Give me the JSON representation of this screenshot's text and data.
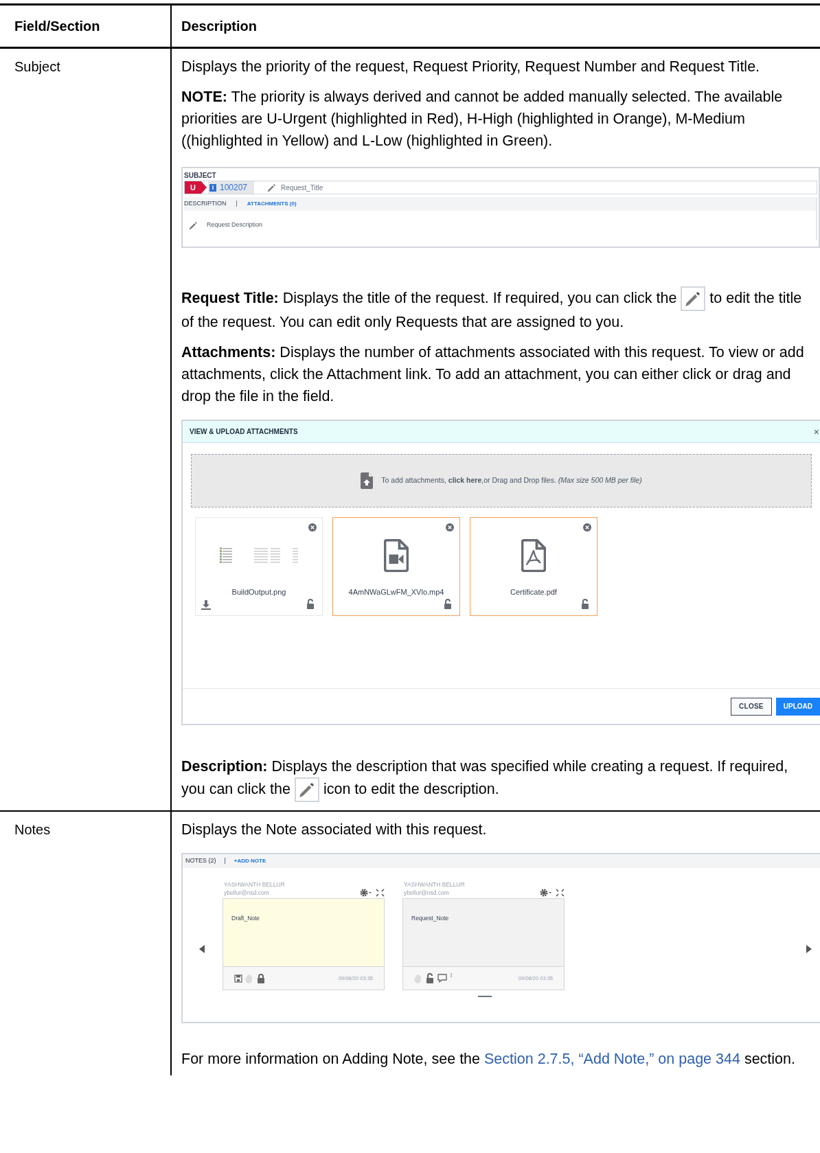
{
  "table": {
    "columns": [
      "Field/Section",
      "Description"
    ],
    "rows": [
      {
        "field": "Subject",
        "blocks": [
          {
            "kind": "paragraph",
            "text": "Displays the priority of the request, Request Priority, Request Number and Request Title."
          },
          {
            "kind": "paragraph",
            "text": "**NOTE:** The priority is always derived and cannot be added manually selected. The available priorities are U-Urgent (highlighted in Red), H-High (highlighted in Orange), M-Medium ((highlighted in Yellow) and L-Low (highlighted in Green)."
          },
          {
            "kind": "subject_panel",
            "label": "SUBJECT",
            "priority": "U",
            "type": "I",
            "number": "100207",
            "title": "Request_Title",
            "tabs": [
              {
                "label": "DESCRIPTION",
                "selected": true
              },
              {
                "label": "ATTACHMENTS (0)",
                "selected": false
              }
            ],
            "separator": "|",
            "description": "Request Description"
          },
          {
            "kind": "icon_paragraph",
            "before": "**Request Title:** Displays the title of the request. If required, you can click the",
            "after": "to edit the title of the request. You can edit only Requests that are assigned to you."
          },
          {
            "kind": "paragraph",
            "text": "**Attachments:** Displays the number of attachments associated with this request. To view or add attachments, click the Attachment link. To add an attachment, you can either click or drag and drop the file in the field."
          },
          {
            "kind": "attachments_dialog",
            "title": "VIEW & UPLOAD ATTACHMENTS",
            "close": "×",
            "drop_text": "To add attachments, **click here**,or Drag and Drop files. *(Max size 500 MB per file)*",
            "files": [
              {
                "name": "BuildOutput.png",
                "kind": "image",
                "selected": false,
                "download": true,
                "locked": false
              },
              {
                "name": "4AmNWaGLwFM_XVlo.mp4",
                "kind": "video",
                "selected": true,
                "download": false,
                "locked": false
              },
              {
                "name": "Certificate.pdf",
                "kind": "pdf",
                "selected": true,
                "download": false,
                "locked": false
              }
            ],
            "buttons": [
              "CLOSE",
              "UPLOAD"
            ]
          },
          {
            "kind": "icon_paragraph",
            "before": "**Description:** Displays the description that was specified while creating a request. If required, you can click the",
            "after": "icon to edit the description."
          }
        ]
      },
      {
        "field": "Notes",
        "blocks": [
          {
            "kind": "paragraph",
            "text": "Displays the Note associated with this request."
          },
          {
            "kind": "notes_panel",
            "header": "NOTES (2)",
            "separator": "|",
            "add": "+ADD NOTE",
            "notes": [
              {
                "author": "YASHWANTH BELLUR",
                "email": "ybellur@nsd.com",
                "text": "Draft_Note",
                "date": "09/08/20 03:35",
                "color": "#fffde1",
                "kind": "draft",
                "locked": true
              },
              {
                "author": "YASHWANTH BELLUR",
                "email": "ybellur@nsd.com",
                "text": "Request_Note",
                "date": "09/08/20 03:35",
                "color": "#f2f2f2",
                "kind": "posted",
                "locked": false,
                "comments": "1"
              }
            ]
          },
          {
            "kind": "link_paragraph",
            "before": "For more information on Adding Note, see the",
            "link": "Section 2.7.5, “Add Note,” on page 344",
            "after": "section."
          }
        ]
      }
    ]
  }
}
